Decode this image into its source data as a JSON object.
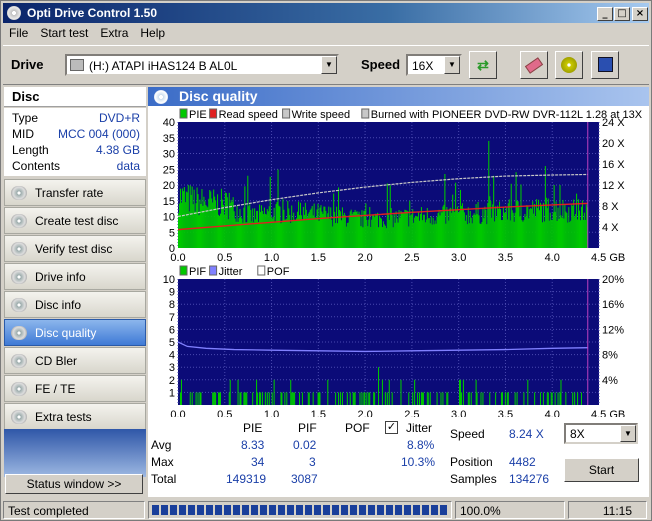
{
  "window": {
    "title": "Opti Drive Control 1.50",
    "min_glyph": "_",
    "max_glyph": "□",
    "close_glyph": "×"
  },
  "menu": [
    "File",
    "Start test",
    "Extra",
    "Help"
  ],
  "toolbar": {
    "drive_label": "Drive",
    "drive_value": "(H:)   ATAPI iHAS124   B AL0L",
    "speed_label": "Speed",
    "speed_value": "16X",
    "buttons": [
      "refresh-icon",
      "eraser-icon",
      "copy-disc-icon",
      "save-icon"
    ]
  },
  "disc": {
    "header": "Disc",
    "rows": [
      {
        "key": "Type",
        "value": "DVD+R"
      },
      {
        "key": "MID",
        "value": "MCC 004 (000)"
      },
      {
        "key": "Length",
        "value": "4.38 GB"
      },
      {
        "key": "Contents",
        "value": "data"
      }
    ]
  },
  "nav": [
    {
      "label": "Transfer rate",
      "active": false
    },
    {
      "label": "Create test disc",
      "active": false
    },
    {
      "label": "Verify test disc",
      "active": false
    },
    {
      "label": "Drive info",
      "active": false
    },
    {
      "label": "Disc info",
      "active": false
    },
    {
      "label": "Disc quality",
      "active": true
    },
    {
      "label": "CD Bler",
      "active": false
    },
    {
      "label": "FE / TE",
      "active": false
    },
    {
      "label": "Extra tests",
      "active": false
    }
  ],
  "status_window_btn": "Status window >>",
  "panel_title": "Disc quality",
  "colors": {
    "pie": "#00c800",
    "read": "#e02020",
    "write": "#c8c8c8",
    "pif": "#00c800",
    "jitter": "#8080ff",
    "pof": "#ffffff",
    "plot_bg": "#0b0b78",
    "accent": "#3b6cc7"
  },
  "chart_data": [
    {
      "type": "bar",
      "legend": [
        {
          "name": "PIE",
          "color": "#00c800"
        },
        {
          "name": "Read speed",
          "color": "#e02020"
        },
        {
          "name": "Write speed",
          "color": "#c8c8c8"
        },
        {
          "name": "Burned with PIONEER DVD-RW  DVR-112L 1.28 at 13X",
          "color": "#c8c8c8"
        }
      ],
      "x_ticks": [
        "0.0",
        "0.5",
        "1.0",
        "1.5",
        "2.0",
        "2.5",
        "3.0",
        "3.5",
        "4.0",
        "4.5 GB"
      ],
      "y_left_ticks": [
        "40",
        "35",
        "30",
        "25",
        "20",
        "15",
        "10",
        "5",
        "0"
      ],
      "y_right_ticks": [
        "24 X",
        "20 X",
        "16 X",
        "12 X",
        "8 X",
        "4 X"
      ],
      "xlim": [
        0,
        4.5
      ],
      "ylim": [
        0,
        40
      ],
      "y2lim": [
        0,
        24
      ],
      "pie_envelope": {
        "x": [
          0,
          0.2,
          0.5,
          0.8,
          1.0,
          1.5,
          2.0,
          2.5,
          3.0,
          3.5,
          4.0,
          4.38
        ],
        "y": [
          20,
          18,
          17,
          12,
          14,
          13,
          11,
          12,
          13,
          14,
          15,
          14
        ]
      },
      "pie_max": 34,
      "read_speed": {
        "x": [
          0,
          0.5,
          1.0,
          1.5,
          2.0,
          2.5,
          3.0,
          3.5,
          4.0,
          4.38
        ],
        "y": [
          3.5,
          4.2,
          4.9,
          5.6,
          6.2,
          6.8,
          7.3,
          7.8,
          8.2,
          8.5
        ]
      },
      "write_speed": {
        "x": [
          0,
          0.5,
          1.0,
          1.5,
          2.0,
          2.5,
          3.0,
          3.5,
          4.0,
          4.38
        ],
        "y": [
          6.0,
          7.7,
          9.2,
          10.5,
          11.6,
          12.5,
          13.2,
          13.7,
          13.9,
          14.0
        ]
      }
    },
    {
      "type": "bar",
      "legend": [
        {
          "name": "PIF",
          "color": "#00c800"
        },
        {
          "name": "Jitter",
          "color": "#8080ff"
        },
        {
          "name": "POF",
          "color": "#ffffff"
        }
      ],
      "x_ticks": [
        "0.0",
        "0.5",
        "1.0",
        "1.5",
        "2.0",
        "2.5",
        "3.0",
        "3.5",
        "4.0",
        "4.5 GB"
      ],
      "y_left_ticks": [
        "10",
        "9",
        "8",
        "7",
        "6",
        "5",
        "4",
        "3",
        "2",
        "1"
      ],
      "y_right_ticks": [
        "20%",
        "16%",
        "12%",
        "8%",
        "4%"
      ],
      "xlim": [
        0,
        4.5
      ],
      "ylim": [
        0,
        10
      ],
      "y2lim": [
        0,
        20
      ],
      "pif_max": 3,
      "jitter": {
        "x": [
          0,
          0.1,
          0.3,
          0.6,
          1.0,
          1.5,
          2.0,
          2.5,
          3.0,
          3.5,
          4.0,
          4.38
        ],
        "y": [
          10.0,
          9.3,
          9.0,
          8.8,
          8.7,
          8.6,
          8.5,
          8.6,
          8.7,
          8.8,
          9.0,
          9.1
        ]
      }
    }
  ],
  "stats": {
    "col_pie": "PIE",
    "col_pif": "PIF",
    "col_pof": "POF",
    "col_jitter": "Jitter",
    "jitter_checked": "✓",
    "avg_label": "Avg",
    "max_label": "Max",
    "total_label": "Total",
    "avg_pie": "8.33",
    "avg_pif": "0.02",
    "avg_jitter": "8.8%",
    "max_pie": "34",
    "max_pif": "3",
    "max_jitter": "10.3%",
    "total_pie": "149319",
    "total_pif": "3087",
    "speed_label": "Speed",
    "speed_value": "8.24 X",
    "speed_select": "8X",
    "position_label": "Position",
    "position_value": "4482",
    "samples_label": "Samples",
    "samples_value": "134276",
    "start_label": "Start"
  },
  "statusbar": {
    "text": "Test completed",
    "progress": 1.0,
    "percent": "100.0%",
    "time": "11:15"
  }
}
